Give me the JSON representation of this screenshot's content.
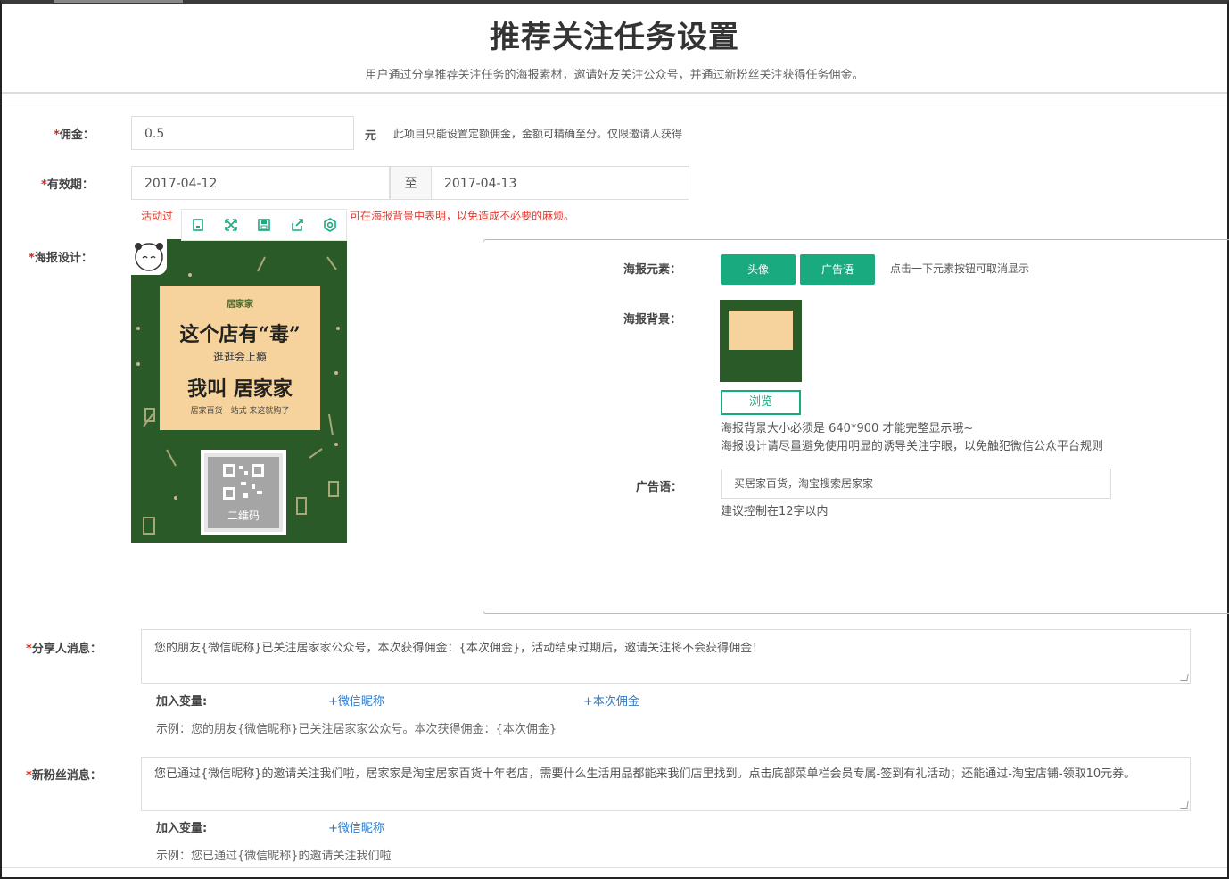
{
  "header": {
    "title": "推荐关注任务设置",
    "subtitle": "用户通过分享推荐关注任务的海报素材，邀请好友关注公众号，并通过新粉丝关注获得任务佣金。"
  },
  "commission": {
    "label": "佣金：",
    "value": "0.5",
    "unit": "元",
    "hint": "此项目只能设置定额佣金，金额可精确至分。仅限邀请人获得"
  },
  "validity": {
    "label": "有效期：",
    "start": "2017-04-12",
    "to": "至",
    "end": "2017-04-13",
    "warning_left": "活动过",
    "warning_right": "可在海报背景中表明，以免造成不必要的麻烦。"
  },
  "poster": {
    "label": "海报设计：",
    "toolbar_icons": [
      "save-icon",
      "expand-icon",
      "disk-icon",
      "share-icon",
      "settings-icon"
    ],
    "brand": "居家家",
    "headline": "这个店有“毒”",
    "sub_headline": "逛逛会上瘾",
    "name_line": "我叫 居家家",
    "tagline": "居家百货一站式 来这就购了",
    "qr_label": "二维码",
    "colors": {
      "bg": "#2a5a27",
      "card": "#f6d39c",
      "accent": "#1aaa80"
    }
  },
  "panel": {
    "elements_label": "海报元素：",
    "element_buttons": [
      "头像",
      "广告语"
    ],
    "elements_hint": "点击一下元素按钮可取消显示",
    "background_label": "海报背景：",
    "browse_label": "浏览",
    "bg_hint_1": "海报背景大小必须是 640*900 才能完整显示哦~",
    "bg_hint_2": "海报设计请尽量避免使用明显的诱导关注字眼，以免触犯微信公众平台规则",
    "slogan_label": "广告语：",
    "slogan_value": "买居家百货，淘宝搜索居家家",
    "slogan_hint": "建议控制在12字以内"
  },
  "share_message": {
    "label": "分享人消息：",
    "value": "您的朋友{微信昵称}已关注居家家公众号，本次获得佣金：{本次佣金}，活动结束过期后，邀请关注将不会获得佣金！",
    "vars_label": "加入变量:",
    "var_1": "+微信昵称",
    "var_2": "+本次佣金",
    "example": "示例：您的朋友{微信昵称}已关注居家家公众号。本次获得佣金：{本次佣金}"
  },
  "fan_message": {
    "label": "新粉丝消息：",
    "value": "您已通过{微信昵称}的邀请关注我们啦，居家家是淘宝居家百货十年老店，需要什么生活用品都能来我们店里找到。点击底部菜单栏会员专属-签到有礼活动；还能通过-淘宝店铺-领取10元券。",
    "vars_label": "加入变量:",
    "var_1": "+微信昵称",
    "example": "示例：您已通过{微信昵称}的邀请关注我们啦"
  }
}
